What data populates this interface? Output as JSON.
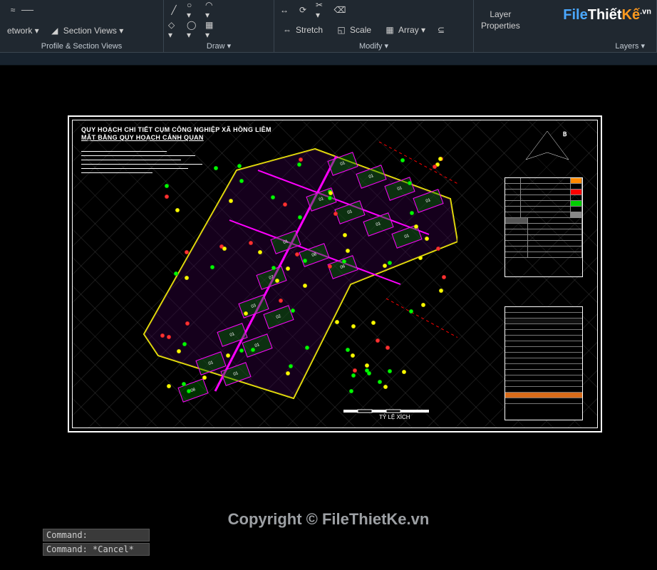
{
  "ribbon": {
    "panel1_items": [
      "etwork ▾",
      "Section Views ▾"
    ],
    "panel1_caption": "Profile & Section Views",
    "panel2_caption": "Draw ▾",
    "panel3_items": [
      "Stretch",
      "Scale",
      "Array ▾"
    ],
    "panel3_caption": "Modify ▾",
    "panel4_layer": "Layer",
    "panel4_props": "Properties",
    "panel4_caption": "Layers ▾"
  },
  "drawing": {
    "title1": "QUY HOẠCH CHI TIẾT CỤM CÔNG NGHIỆP XÃ HỒNG LIÊM",
    "title2": "MẶT BẰNG QUY HOẠCH CẢNH QUAN",
    "scale_label": "TỶ LỆ XÍCH",
    "lots": [
      "01",
      "01",
      "01",
      "01",
      "01",
      "01",
      "01",
      "01",
      "01",
      "08",
      "06",
      "07",
      "03",
      "02",
      "01",
      "01",
      "01",
      "01",
      "08"
    ]
  },
  "watermark": {
    "logo_pre": "File",
    "logo_mid": "Thiết",
    "logo_k": "Kế",
    "logo_vn": ".vn",
    "copyright": "Copyright © FileThietKe.vn"
  },
  "cmd": {
    "line1": "Command:",
    "line2": "Command: *Cancel*"
  }
}
